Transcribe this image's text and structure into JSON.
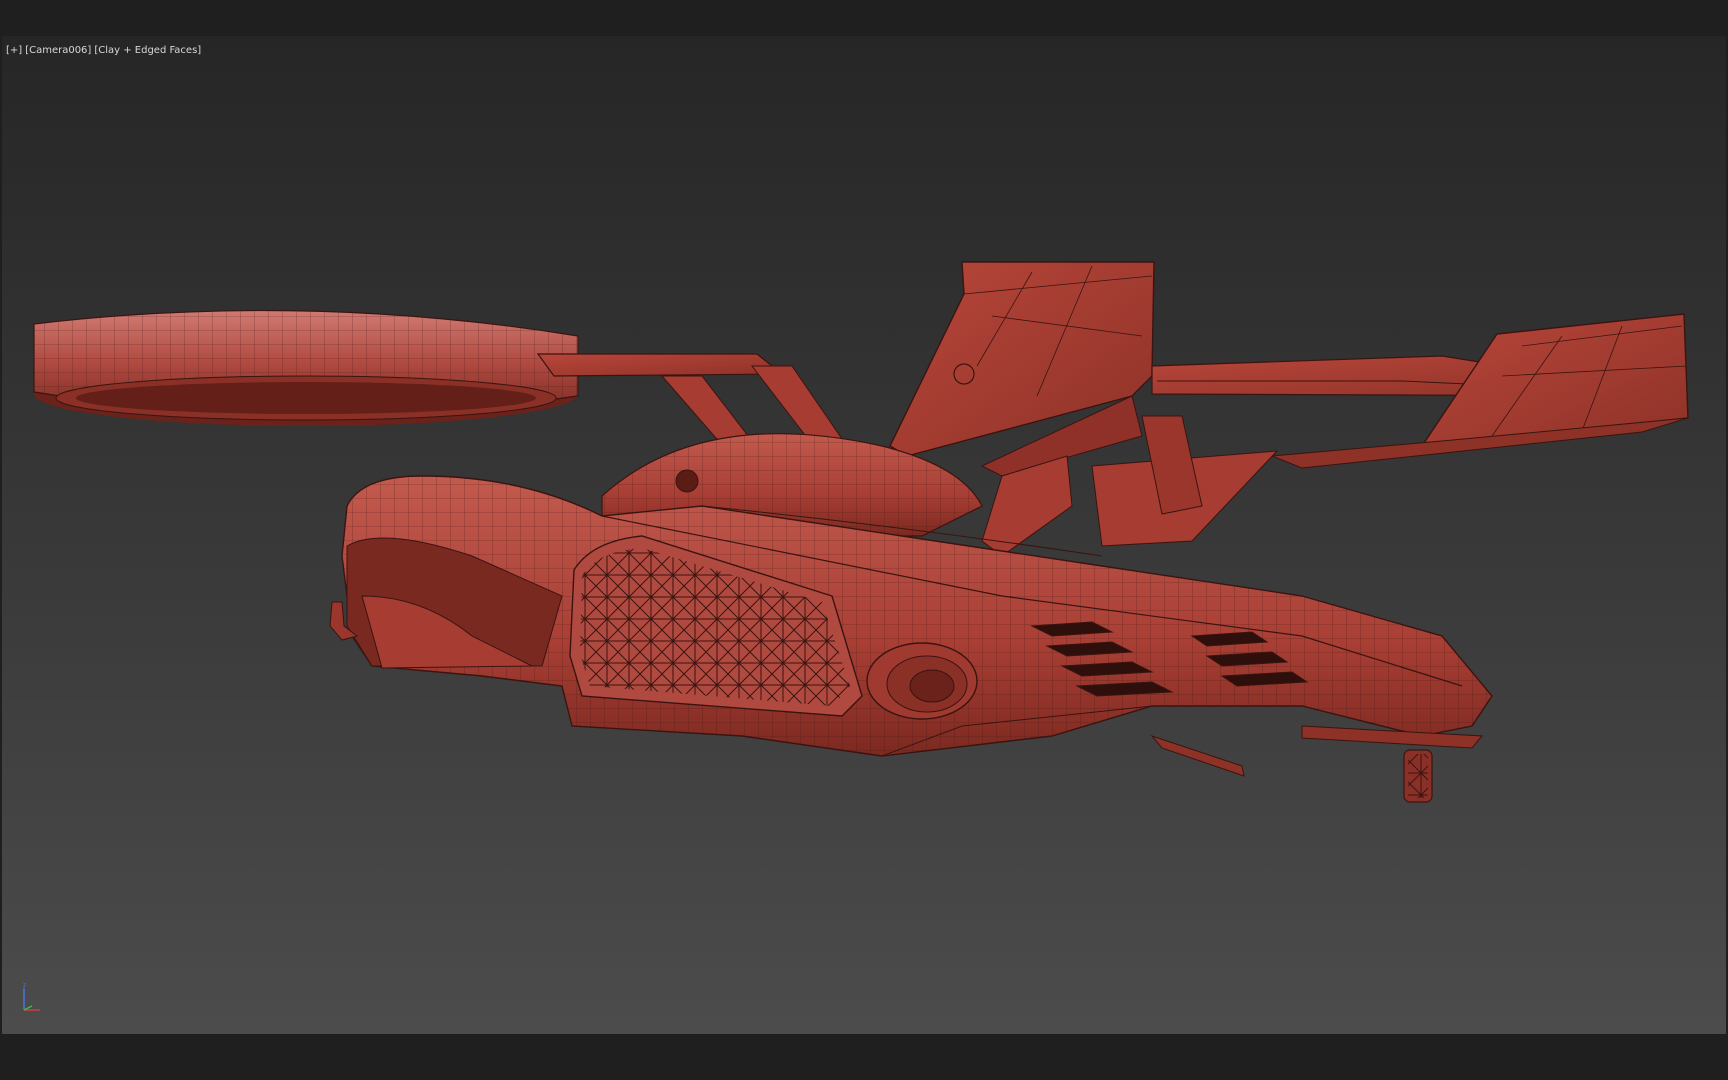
{
  "viewport": {
    "label_parts": [
      "[+]",
      "[Camera006]",
      "[Clay + Edged Faces]"
    ]
  },
  "gizmo": {
    "axis_z_label": "z",
    "colors": {
      "x": "#d04040",
      "y": "#40c040",
      "z": "#4a78e0"
    }
  },
  "model": {
    "name_icon": "flying-car-model",
    "clay_color": "#b8463a",
    "edge_color": "#3a1410"
  }
}
